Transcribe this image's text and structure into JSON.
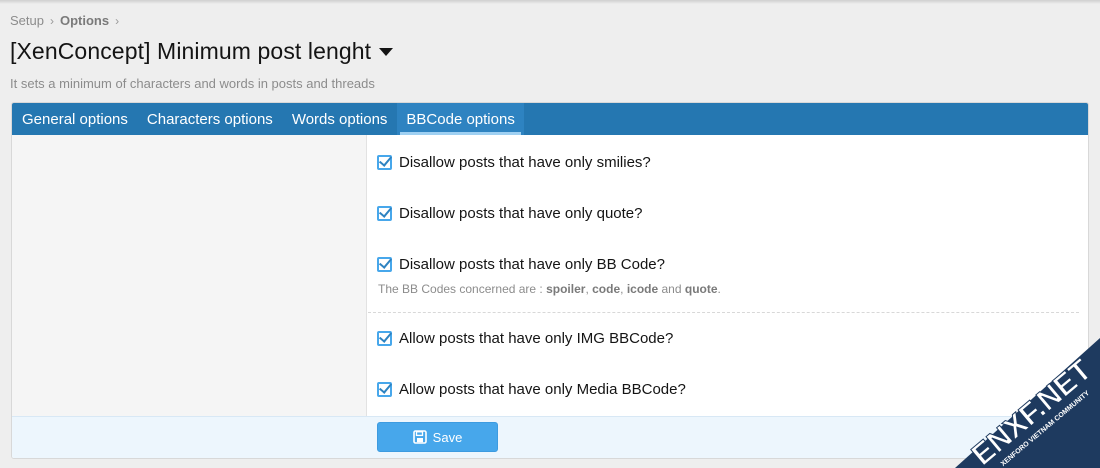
{
  "breadcrumb": {
    "items": [
      "Setup",
      "Options"
    ]
  },
  "page": {
    "title": "[XenConcept] Minimum post lenght",
    "description": "It sets a minimum of characters and words in posts and threads"
  },
  "tabs": [
    {
      "label": "General options"
    },
    {
      "label": "Characters options"
    },
    {
      "label": "Words options"
    },
    {
      "label": "BBCode options",
      "active": true
    }
  ],
  "options": [
    {
      "label": "Disallow posts that have only smilies?",
      "checked": true
    },
    {
      "label": "Disallow posts that have only quote?",
      "checked": true
    },
    {
      "label": "Disallow posts that have only BB Code?",
      "checked": true
    },
    {
      "label": "Allow posts that have only IMG BBCode?",
      "checked": true
    },
    {
      "label": "Allow posts that have only Media BBCode?",
      "checked": true
    }
  ],
  "bbcode_hint": {
    "prefix": "The BB Codes concerned are : ",
    "codes": [
      "spoiler",
      "code",
      "icode",
      "quote"
    ],
    "sep": ", ",
    "and": " and ",
    "suffix": "."
  },
  "footer": {
    "save_label": "Save"
  },
  "watermark": {
    "text": "ENXF.NET",
    "subtext": "XENFORO VIETNAM COMMUNITY"
  },
  "colors": {
    "tab_bar": "#2577b1",
    "accent": "#47a7eb",
    "footer_bg": "#edf6fd",
    "watermark": "#1e3a5f"
  }
}
